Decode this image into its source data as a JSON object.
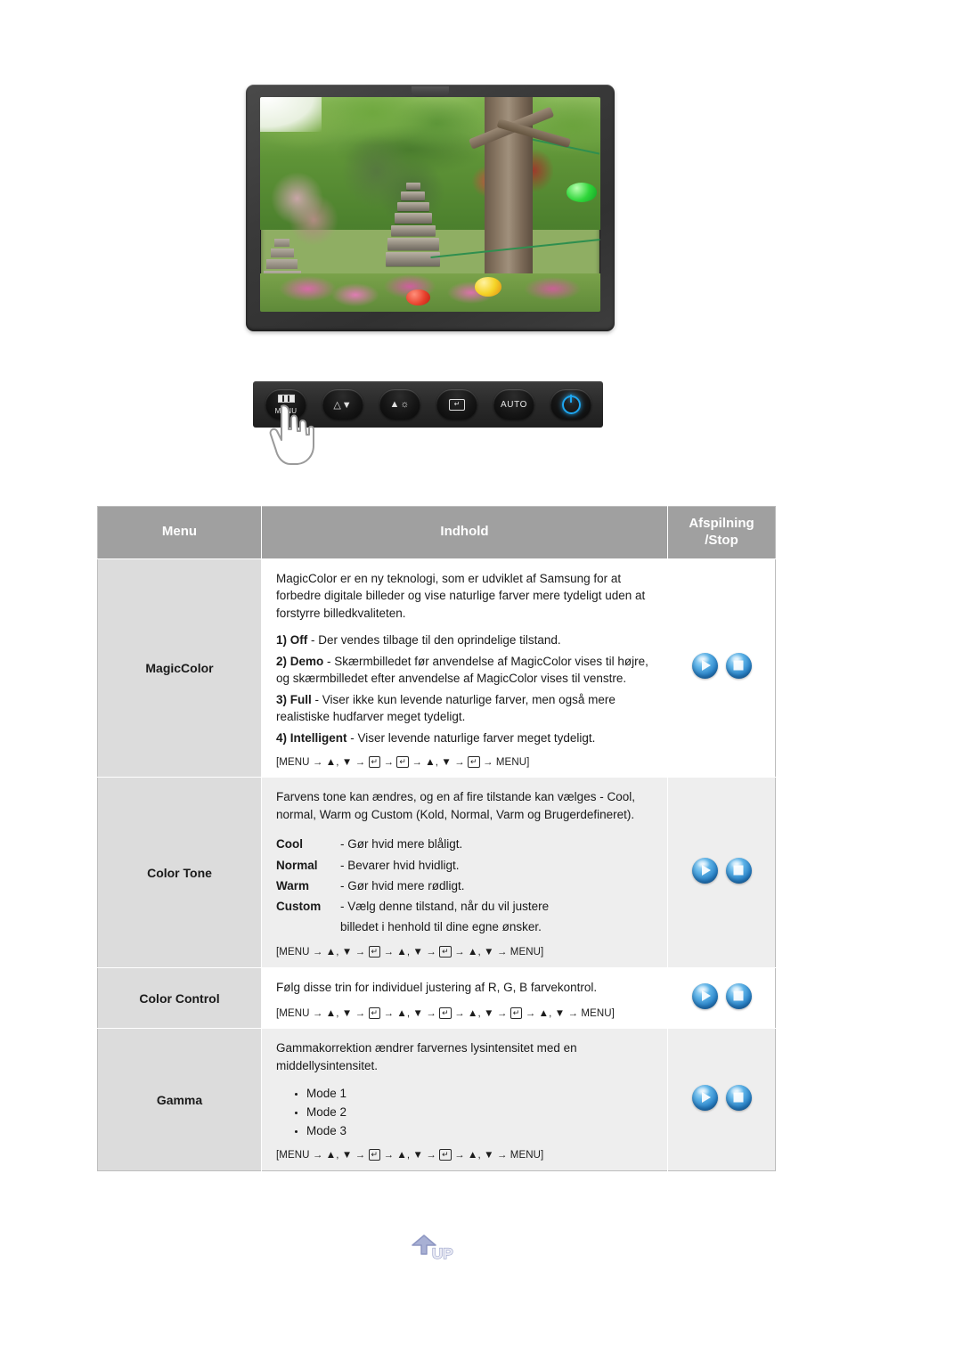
{
  "monitor": {
    "screen_alt": "garden-photo-with-stone-pagoda",
    "control_buttons": [
      {
        "name": "menu-button",
        "label": "MENU"
      },
      {
        "name": "source-down-button",
        "label": ""
      },
      {
        "name": "brightness-up-button",
        "label": ""
      },
      {
        "name": "enter-button",
        "label": ""
      },
      {
        "name": "auto-button",
        "label": "AUTO"
      },
      {
        "name": "power-button",
        "label": ""
      }
    ]
  },
  "table": {
    "headers": {
      "menu": "Menu",
      "indhold": "Indhold",
      "playstop_line1": "Afspilning",
      "playstop_line2": "/Stop"
    },
    "rows": [
      {
        "menu": "MagicColor",
        "intro": "MagicColor er en ny teknologi, som er udviklet af Samsung for at forbedre digitale billeder og vise naturlige farver mere tydeligt uden at forstyrre billedkvaliteten.",
        "options": [
          {
            "num": "1) Off",
            "desc": " - Der vendes tilbage til den oprindelige tilstand."
          },
          {
            "num": "2) Demo",
            "desc": " - Skærmbilledet før anvendelse af MagicColor vises til højre, og skærmbilledet efter anvendelse af MagicColor vises til venstre."
          },
          {
            "num": "3) Full",
            "desc": " - Viser ikke kun levende naturlige farver, men også mere realistiske hudfarver meget tydeligt."
          },
          {
            "num": "4) Intelligent",
            "desc": " - Viser levende naturlige farver meget tydeligt."
          }
        ],
        "sequence": "[MENU → ▲,▼ → ⏎ → ⏎ → ▲,▼ → ⏎ → MENU]",
        "sequence_parts": [
          "[MENU",
          "▲, ▼",
          "KBD",
          "KBD",
          "▲, ▼",
          "KBD",
          "MENU]"
        ]
      },
      {
        "menu": "Color Tone",
        "intro": "Farvens tone kan ændres, og en af fire tilstande kan vælges - Cool, normal, Warm og Custom (Kold, Normal, Varm og Brugerdefineret).",
        "tones": [
          {
            "name": "Cool",
            "desc": "- Gør hvid mere blåligt."
          },
          {
            "name": "Normal",
            "desc": "- Bevarer hvid hvidligt."
          },
          {
            "name": "Warm",
            "desc": "- Gør hvid mere rødligt."
          },
          {
            "name": "Custom",
            "desc": "- Vælg denne tilstand, når du vil justere",
            "desc2": "billedet i henhold til dine egne ønsker."
          }
        ],
        "sequence_parts": [
          "[MENU",
          "▲, ▼",
          "KBD",
          "▲, ▼",
          "KBD",
          "▲, ▼",
          "MENU]"
        ]
      },
      {
        "menu": "Color Control",
        "intro": "Følg disse trin for individuel justering af R, G, B farvekontrol.",
        "sequence_parts": [
          "[MENU",
          "▲, ▼",
          "KBD",
          "▲, ▼",
          "KBD",
          "▲, ▼",
          "KBD",
          "▲, ▼",
          "MENU]"
        ]
      },
      {
        "menu": "Gamma",
        "intro": "Gammakorrektion ændrer farvernes lysintensitet med en middellysintensitet.",
        "modes": [
          "Mode 1",
          "Mode 2",
          "Mode 3"
        ],
        "sequence_parts": [
          "[MENU",
          "▲, ▼",
          "KBD",
          "▲, ▼",
          "KBD",
          "▲, ▼",
          "MENU]"
        ]
      }
    ]
  },
  "up_button": {
    "label": "UP"
  },
  "colors": {
    "header_bg": "#a0a0a0",
    "menu_col_bg": "#dcdcdc",
    "row_tint_bg": "#eeeeee",
    "accent_blue": "#2a84c9",
    "power_blue": "#1ea6ef"
  }
}
